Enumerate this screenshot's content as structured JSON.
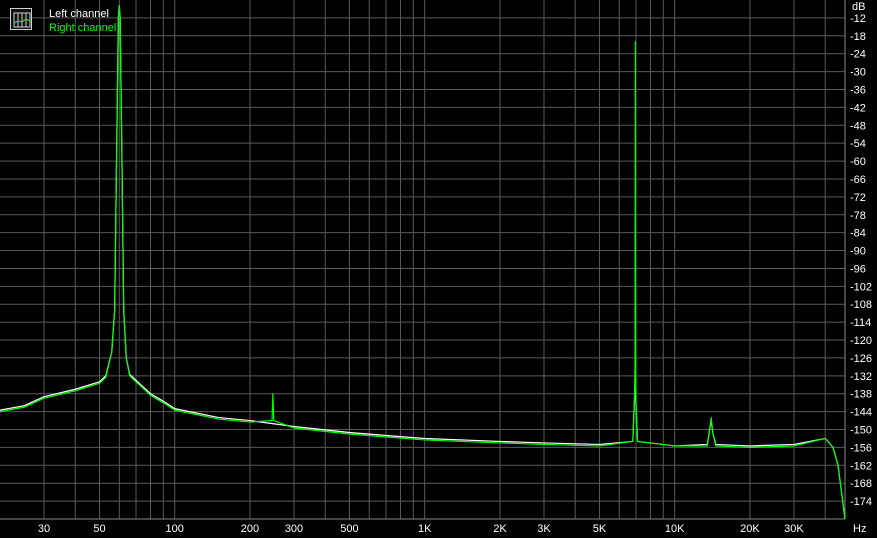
{
  "chart_data": {
    "type": "line",
    "xscale": "log",
    "xlim": [
      20,
      48000
    ],
    "ylim": [
      -180,
      -6
    ],
    "xunit": "Hz",
    "yunit": "dB",
    "grid": true,
    "legend_position": "top-left",
    "x_tick_labels": [
      {
        "value": 30,
        "label": "30"
      },
      {
        "value": 50,
        "label": "50"
      },
      {
        "value": 100,
        "label": "100"
      },
      {
        "value": 200,
        "label": "200"
      },
      {
        "value": 300,
        "label": "300"
      },
      {
        "value": 500,
        "label": "500"
      },
      {
        "value": 1000,
        "label": "1K"
      },
      {
        "value": 2000,
        "label": "2K"
      },
      {
        "value": 3000,
        "label": "3K"
      },
      {
        "value": 5000,
        "label": "5K"
      },
      {
        "value": 10000,
        "label": "10K"
      },
      {
        "value": 20000,
        "label": "20K"
      },
      {
        "value": 30000,
        "label": "30K"
      }
    ],
    "x_grid_values": [
      30,
      40,
      50,
      60,
      70,
      80,
      90,
      100,
      200,
      300,
      400,
      500,
      600,
      700,
      800,
      900,
      1000,
      2000,
      3000,
      4000,
      5000,
      6000,
      7000,
      8000,
      9000,
      10000,
      20000,
      30000,
      40000
    ],
    "y_ticks": [
      -12,
      -18,
      -24,
      -30,
      -36,
      -42,
      -48,
      -54,
      -60,
      -66,
      -72,
      -78,
      -84,
      -90,
      -96,
      -102,
      -108,
      -114,
      -120,
      -126,
      -132,
      -138,
      -144,
      -150,
      -156,
      -162,
      -168,
      -174
    ],
    "series": [
      {
        "name": "Left channel",
        "color": "#ffffff",
        "points": [
          [
            20,
            -143.5
          ],
          [
            25,
            -142
          ],
          [
            30,
            -139
          ],
          [
            40,
            -136.5
          ],
          [
            50,
            -134
          ],
          [
            53,
            -132
          ],
          [
            56,
            -124
          ],
          [
            57.5,
            -110
          ],
          [
            58.5,
            -60
          ],
          [
            59.5,
            -12
          ],
          [
            60,
            -8
          ],
          [
            60.5,
            -12
          ],
          [
            61.5,
            -60
          ],
          [
            62.5,
            -110
          ],
          [
            64,
            -126
          ],
          [
            66,
            -131.5
          ],
          [
            70,
            -133.5
          ],
          [
            80,
            -138
          ],
          [
            90,
            -140.5
          ],
          [
            100,
            -143
          ],
          [
            150,
            -146
          ],
          [
            200,
            -147
          ],
          [
            300,
            -149
          ],
          [
            500,
            -151
          ],
          [
            700,
            -152
          ],
          [
            1000,
            -153
          ],
          [
            2000,
            -154
          ],
          [
            3000,
            -154.5
          ],
          [
            5000,
            -155
          ],
          [
            6800,
            -154
          ],
          [
            6900,
            -140
          ],
          [
            6950,
            -136
          ],
          [
            7000,
            -142
          ],
          [
            7100,
            -154
          ],
          [
            10000,
            -155.5
          ],
          [
            13500,
            -155
          ],
          [
            13800,
            -150
          ],
          [
            14000,
            -147
          ],
          [
            14200,
            -151
          ],
          [
            14600,
            -155
          ],
          [
            20000,
            -155.5
          ],
          [
            30000,
            -155
          ],
          [
            40000,
            -153
          ],
          [
            43000,
            -156
          ],
          [
            45000,
            -162
          ],
          [
            47000,
            -174
          ],
          [
            48000,
            -180
          ]
        ]
      },
      {
        "name": "Right channel",
        "color": "#00ff00",
        "points": [
          [
            20,
            -144
          ],
          [
            25,
            -142.5
          ],
          [
            30,
            -139.5
          ],
          [
            40,
            -137
          ],
          [
            50,
            -134.5
          ],
          [
            53,
            -132.5
          ],
          [
            56,
            -124
          ],
          [
            57.5,
            -110
          ],
          [
            58.5,
            -60
          ],
          [
            59.5,
            -12
          ],
          [
            60,
            -8
          ],
          [
            60.5,
            -12
          ],
          [
            61.5,
            -60
          ],
          [
            62.5,
            -110
          ],
          [
            64,
            -126
          ],
          [
            66,
            -132
          ],
          [
            70,
            -134
          ],
          [
            80,
            -138.5
          ],
          [
            90,
            -141
          ],
          [
            100,
            -143.5
          ],
          [
            150,
            -146.5
          ],
          [
            200,
            -147.5
          ],
          [
            245,
            -147
          ],
          [
            247,
            -138
          ],
          [
            249,
            -147
          ],
          [
            300,
            -149.5
          ],
          [
            500,
            -151.5
          ],
          [
            700,
            -152.5
          ],
          [
            1000,
            -153.5
          ],
          [
            2000,
            -154.5
          ],
          [
            3000,
            -155
          ],
          [
            5000,
            -155.5
          ],
          [
            6800,
            -154
          ],
          [
            6900,
            -140
          ],
          [
            6940,
            -128
          ],
          [
            6960,
            -20
          ],
          [
            6980,
            -128
          ],
          [
            7000,
            -140
          ],
          [
            7100,
            -154
          ],
          [
            10000,
            -155.5
          ],
          [
            13500,
            -155.5
          ],
          [
            13800,
            -150
          ],
          [
            14000,
            -146
          ],
          [
            14200,
            -151
          ],
          [
            14600,
            -155.5
          ],
          [
            20000,
            -156
          ],
          [
            30000,
            -155.5
          ],
          [
            40000,
            -153
          ],
          [
            43000,
            -156
          ],
          [
            45000,
            -162
          ],
          [
            47000,
            -174
          ],
          [
            48000,
            -180
          ]
        ]
      }
    ]
  }
}
